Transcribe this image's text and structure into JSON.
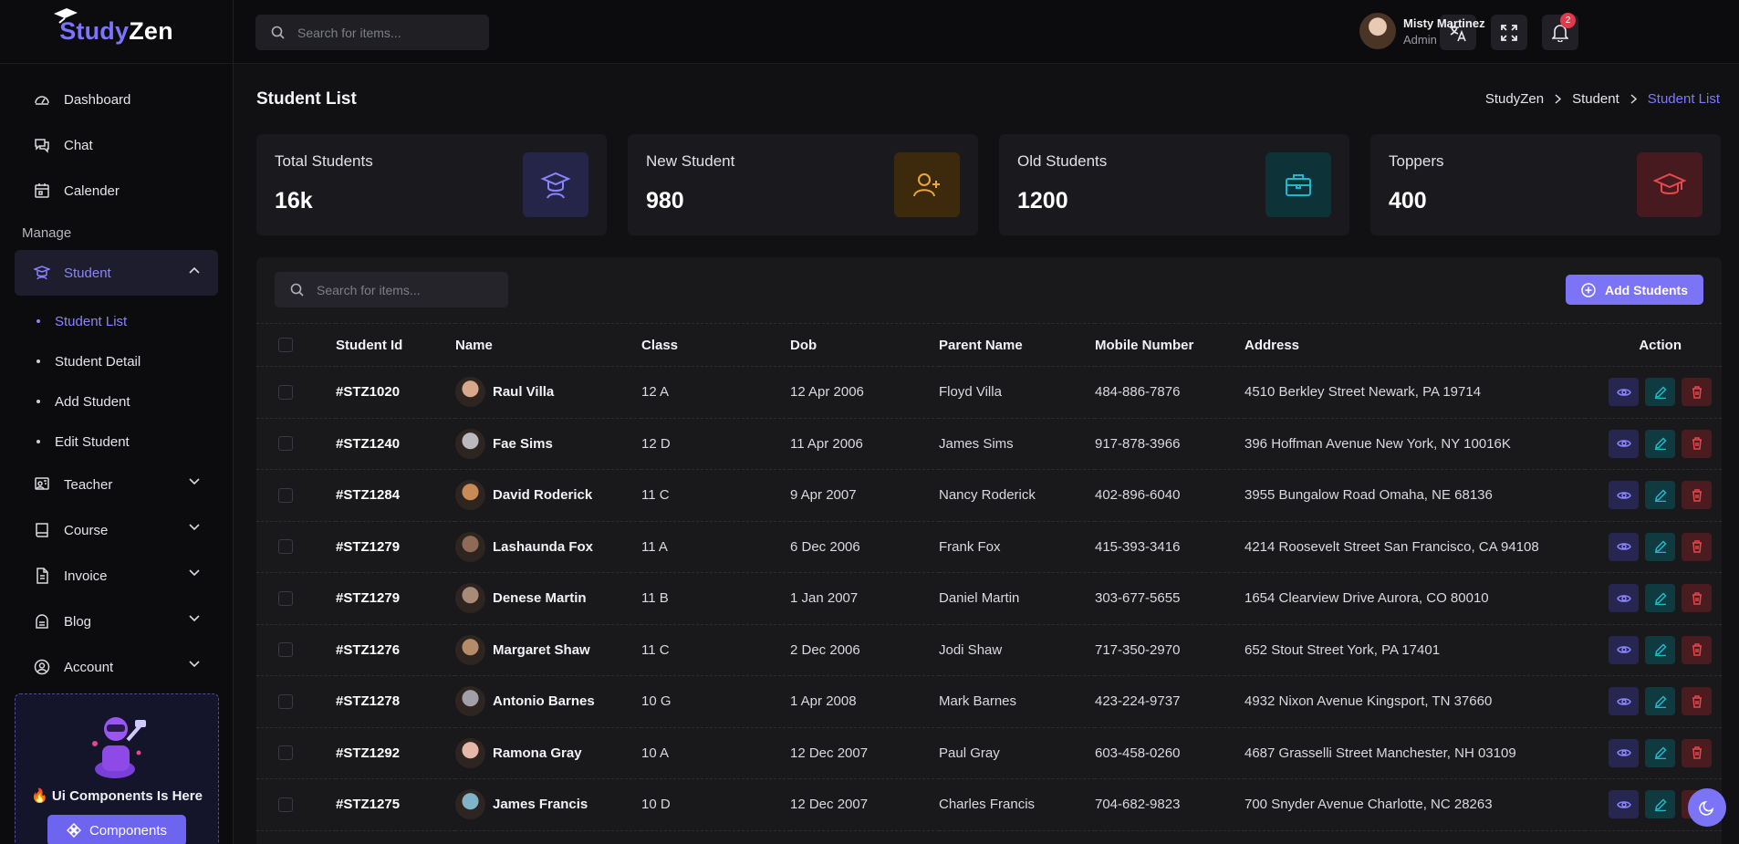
{
  "brand": {
    "name_a": "Study",
    "name_b": "Zen"
  },
  "topbar": {
    "search_placeholder": "Search for items...",
    "notification_count": "2",
    "user_name": "Misty Martinez",
    "user_role": "Admin"
  },
  "sidebar": {
    "main_items": [
      {
        "label": "Dashboard",
        "icon": "dashboard-icon"
      },
      {
        "label": "Chat",
        "icon": "chat-icon"
      },
      {
        "label": "Calender",
        "icon": "calendar-icon"
      }
    ],
    "section_label": "Manage",
    "student": {
      "label": "Student",
      "sub_items": [
        "Student List",
        "Student Detail",
        "Add Student",
        "Edit Student"
      ]
    },
    "other_items": [
      {
        "label": "Teacher",
        "icon": "teacher-icon"
      },
      {
        "label": "Course",
        "icon": "course-icon"
      },
      {
        "label": "Invoice",
        "icon": "invoice-icon"
      },
      {
        "label": "Blog",
        "icon": "blog-icon"
      },
      {
        "label": "Account",
        "icon": "account-icon"
      }
    ],
    "promo": {
      "title": "🔥 Ui Components Is Here",
      "button": "Components"
    }
  },
  "page": {
    "title": "Student List",
    "breadcrumb": [
      "StudyZen",
      "Student",
      "Student List"
    ]
  },
  "stats": [
    {
      "label": "Total Students",
      "value": "16k",
      "color": "#8a84ff",
      "bg": "#25254a"
    },
    {
      "label": "New Student",
      "value": "980",
      "color": "#f0a53a",
      "bg": "#3d2a0c"
    },
    {
      "label": "Old Students",
      "value": "1200",
      "color": "#22b7c9",
      "bg": "#0d3339"
    },
    {
      "label": "Toppers",
      "value": "400",
      "color": "#e5484d",
      "bg": "#461a1e"
    }
  ],
  "list": {
    "search_placeholder": "Search for items...",
    "add_button": "Add Students",
    "columns": [
      "Student Id",
      "Name",
      "Class",
      "Dob",
      "Parent Name",
      "Mobile Number",
      "Address",
      "Action"
    ],
    "rows": [
      {
        "id": "#STZ1020",
        "name": "Raul Villa",
        "class": "12 A",
        "dob": "12 Apr 2006",
        "parent": "Floyd Villa",
        "mobile": "484-886-7876",
        "address": "4510 Berkley Street Newark, PA 19714"
      },
      {
        "id": "#STZ1240",
        "name": "Fae Sims",
        "class": "12 D",
        "dob": "11 Apr 2006",
        "parent": "James Sims",
        "mobile": "917-878-3966",
        "address": "396 Hoffman Avenue New York, NY 10016K"
      },
      {
        "id": "#STZ1284",
        "name": "David Roderick",
        "class": "11 C",
        "dob": "9 Apr 2007",
        "parent": "Nancy Roderick",
        "mobile": "402-896-6040",
        "address": "3955 Bungalow Road Omaha, NE 68136"
      },
      {
        "id": "#STZ1279",
        "name": "Lashaunda Fox",
        "class": "11 A",
        "dob": "6 Dec 2006",
        "parent": "Frank Fox",
        "mobile": "415-393-3416",
        "address": "4214 Roosevelt Street San Francisco, CA 94108"
      },
      {
        "id": "#STZ1279",
        "name": "Denese Martin",
        "class": "11 B",
        "dob": "1 Jan 2007",
        "parent": "Daniel Martin",
        "mobile": "303-677-5655",
        "address": "1654 Clearview Drive Aurora, CO 80010"
      },
      {
        "id": "#STZ1276",
        "name": "Margaret Shaw",
        "class": "11 C",
        "dob": "2 Dec 2006",
        "parent": "Jodi Shaw",
        "mobile": "717-350-2970",
        "address": "652 Stout Street York, PA 17401"
      },
      {
        "id": "#STZ1278",
        "name": "Antonio Barnes",
        "class": "10 G",
        "dob": "1 Apr 2008",
        "parent": "Mark Barnes",
        "mobile": "423-224-9737",
        "address": "4932 Nixon Avenue Kingsport, TN 37660"
      },
      {
        "id": "#STZ1292",
        "name": "Ramona Gray",
        "class": "10 A",
        "dob": "12 Dec 2007",
        "parent": "Paul Gray",
        "mobile": "603-458-0260",
        "address": "4687 Grasselli Street Manchester, NH 03109"
      },
      {
        "id": "#STZ1275",
        "name": "James Francis",
        "class": "10 D",
        "dob": "12 Dec 2007",
        "parent": "Charles Francis",
        "mobile": "704-682-9823",
        "address": "700 Snyder Avenue Charlotte, NC 28263"
      }
    ]
  }
}
